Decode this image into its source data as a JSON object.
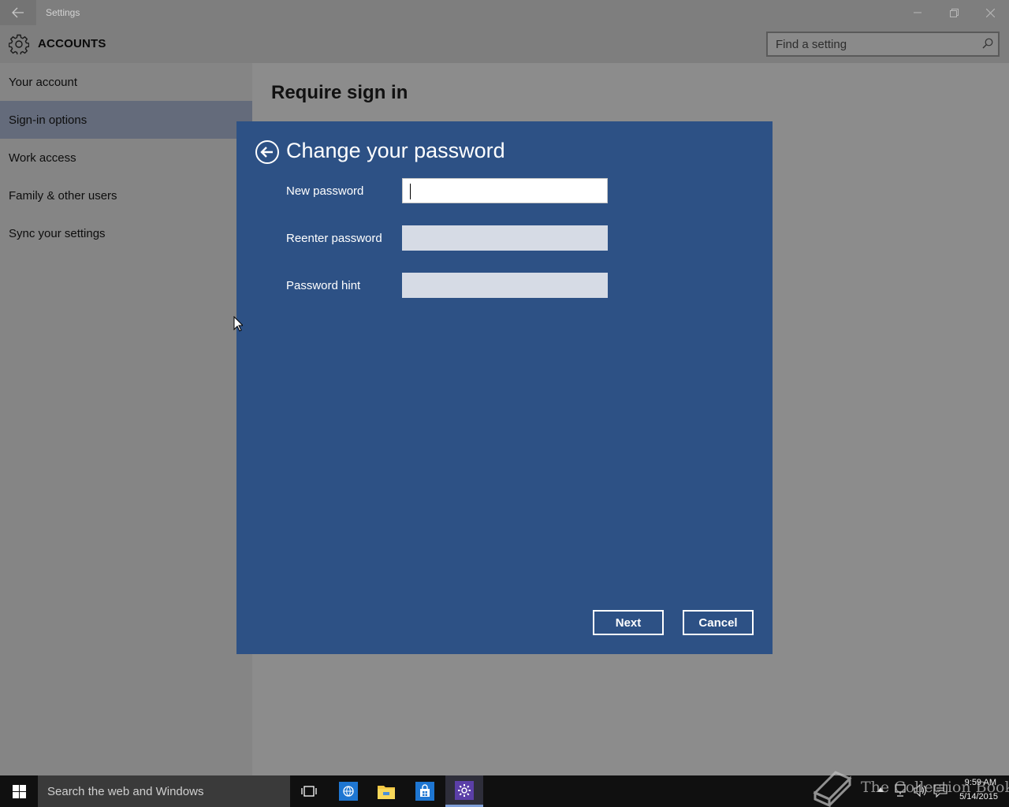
{
  "window": {
    "title": "Settings",
    "controls": [
      "minimize",
      "maximize",
      "close"
    ]
  },
  "header": {
    "title": "ACCOUNTS",
    "icon": "gear-icon",
    "search_placeholder": "Find a setting"
  },
  "sidebar": {
    "items": [
      {
        "label": "Your account",
        "active": false
      },
      {
        "label": "Sign-in options",
        "active": true
      },
      {
        "label": "Work access",
        "active": false
      },
      {
        "label": "Family & other users",
        "active": false
      },
      {
        "label": "Sync your settings",
        "active": false
      }
    ]
  },
  "content": {
    "title": "Require sign in"
  },
  "dialog": {
    "title": "Change your password",
    "fields": [
      {
        "label": "New password",
        "value": ""
      },
      {
        "label": "Reenter password",
        "value": ""
      },
      {
        "label": "Password hint",
        "value": ""
      }
    ],
    "next_label": "Next",
    "cancel_label": "Cancel",
    "colors": {
      "background": "#2d5185",
      "text": "#ffffff"
    }
  },
  "taskbar": {
    "search_placeholder": "Search the web and Windows",
    "apps": [
      "task-view-icon",
      "browser-icon",
      "file-explorer-icon",
      "store-icon",
      "settings-icon"
    ],
    "active_app": "settings-icon",
    "time": "9:59 AM",
    "date": "5/14/2015"
  },
  "watermark": {
    "text": "The Collection Book"
  }
}
